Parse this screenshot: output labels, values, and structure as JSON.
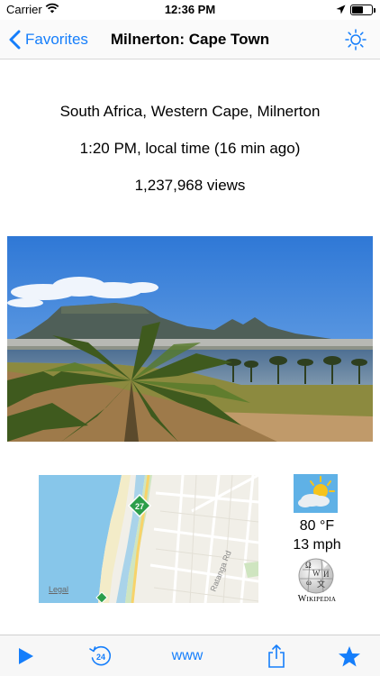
{
  "status_bar": {
    "carrier": "Carrier",
    "time": "12:36 PM",
    "battery_level": 0.55
  },
  "nav": {
    "back_label": "Favorites",
    "title": "Milnerton: Cape Town"
  },
  "info": {
    "location": "South Africa, Western Cape, Milnerton",
    "local_time": "1:20 PM, local time (16 min ago)",
    "views": "1,237,968 views"
  },
  "map": {
    "legal_label": "Legal",
    "street_label": "Ratanga Rd",
    "route_number": "27"
  },
  "weather": {
    "temperature": "80 °F",
    "wind": "13 mph"
  },
  "wikipedia_label": "Wikipedia",
  "toolbar": {
    "www_label": "www",
    "history_badge": "24"
  },
  "colors": {
    "accent": "#157efb"
  }
}
